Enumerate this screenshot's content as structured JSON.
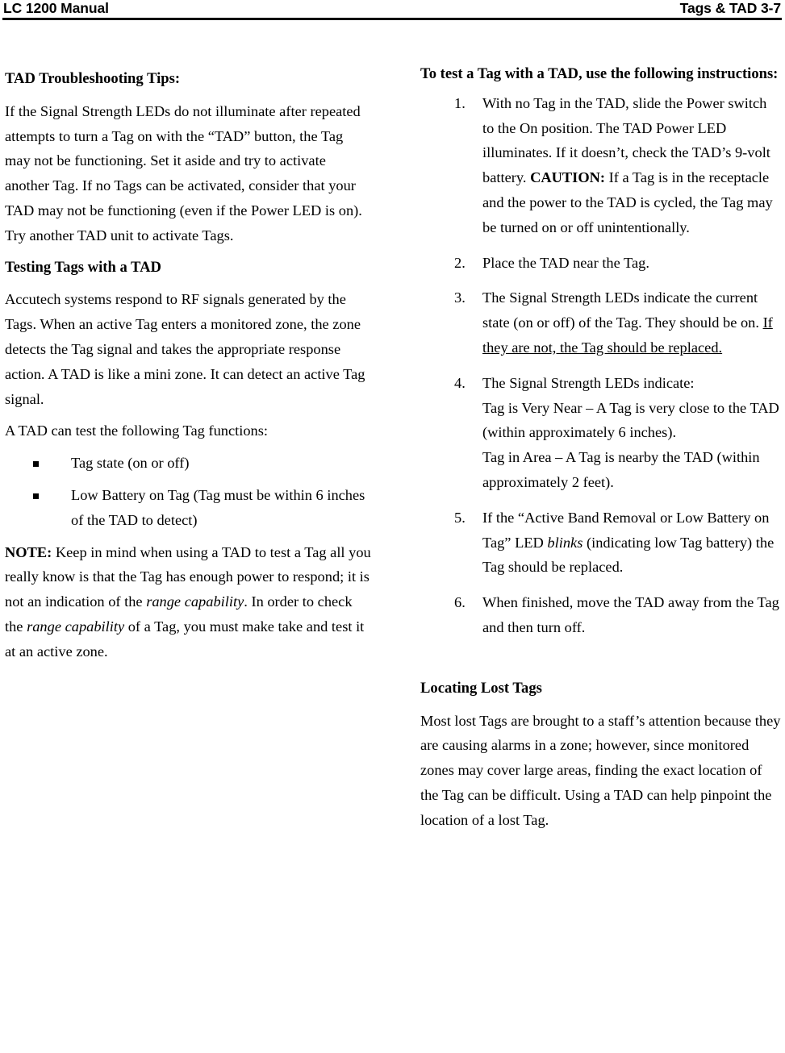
{
  "header": {
    "left": "LC 1200 Manual",
    "right": "Tags & TAD 3-7"
  },
  "left_column": {
    "heading_1": "TAD Troubleshooting Tips:",
    "para_1": "If the Signal Strength LEDs do not illuminate after repeated attempts to turn a Tag on with the “TAD” button, the Tag may not be functioning. Set it aside and try to activate another Tag. If no Tags can be activated, consider that your TAD may not be functioning (even if the Power LED is on). Try another TAD unit to activate Tags.",
    "heading_2": "Testing Tags with a TAD",
    "para_2": "Accutech systems respond to RF signals generated by the Tags. When an active Tag enters a monitored zone, the zone detects the Tag signal and takes the appropriate response action. A TAD is like a mini zone. It can detect an active Tag signal.",
    "para_3": "A TAD can test the following Tag functions:",
    "bullets": [
      "Tag state (on or off)",
      "Low Battery on Tag (Tag must be within 6 inches of the TAD to detect)"
    ],
    "note": {
      "label": "NOTE:",
      "text_1": " Keep in mind when using a TAD to test a Tag all you really know is that the Tag has enough power to respond; it is not an indication of the ",
      "italic_1": "range capability",
      "text_2": ". In order to check the ",
      "italic_2": "range capability",
      "text_3": " of a Tag, you must make take and test it at an active zone."
    }
  },
  "right_column": {
    "heading_1": "To test a Tag with a TAD, use the following instructions:",
    "steps": [
      {
        "number": "1.",
        "text_1": "With no Tag in the TAD, slide the Power switch to the On position. The TAD Power LED illuminates. If it doesn’t, check the TAD’s 9-volt battery. ",
        "bold": "CAUTION:",
        "text_2": " If a Tag is in the receptacle and the power to the TAD is cycled, the Tag may be turned on or off unintentionally."
      },
      {
        "number": "2.",
        "text_1": "Place the TAD near the Tag."
      },
      {
        "number": "3.",
        "text_1": "The Signal Strength LEDs indicate the current state (on or off) of the Tag. They should be on. ",
        "underline": "If they are not, the Tag should be replaced."
      },
      {
        "number": "4.",
        "line_1": "The Signal Strength LEDs indicate:",
        "line_2": "Tag is Very Near – A Tag is very close to the TAD (within approximately 6 inches).",
        "line_3": "Tag in Area – A Tag is nearby the TAD (within approximately 2 feet)."
      },
      {
        "number": "5.",
        "text_1": "If the “Active Band Removal or Low Battery on Tag” LED ",
        "italic": "blinks",
        "text_2": " (indicating low Tag battery) the Tag should be replaced."
      },
      {
        "number": "6.",
        "text_1": "When finished, move the TAD away from the Tag and then turn off."
      }
    ],
    "heading_2": "Locating Lost Tags",
    "para_1": "Most lost Tags are brought to a staff’s attention because they are causing alarms in a zone; however, since monitored zones may cover large areas, finding the exact location of the Tag can be difficult. Using a TAD can help pinpoint the location of a lost Tag."
  }
}
